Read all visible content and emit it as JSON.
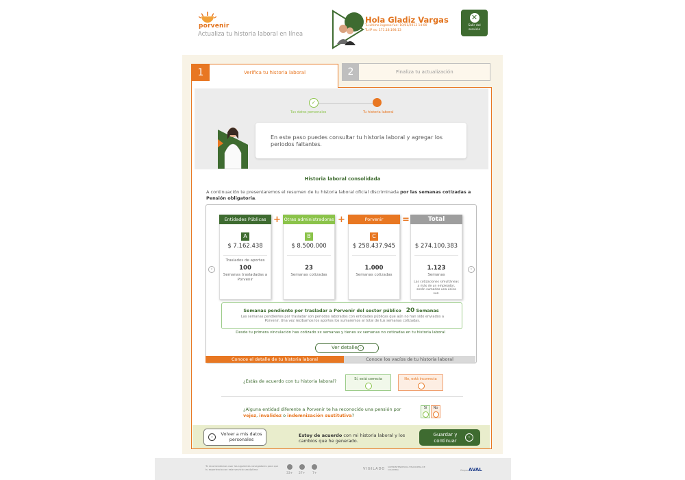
{
  "header": {
    "brand": "porvenir",
    "tagline": "Actualiza tu historia laboral en línea",
    "greeting": "Hola Gladiz Vargas",
    "last_login": "Tu último ingreso fue: 10/01/2013 14:00",
    "ip": "Tu IP es: 171.18.198.13",
    "exit_label_1": "Salir del",
    "exit_label_2": "servicio"
  },
  "tabs": [
    {
      "num": "1",
      "label": "Verifica tu historia laboral"
    },
    {
      "num": "2",
      "label": "Finaliza tu actualización"
    }
  ],
  "stepper": {
    "step1": "Tus datos personales",
    "step2": "Tu historia laboral"
  },
  "intro_bubble": "En este paso puedes consultar tu historia laboral y agregar los periodos faltantes.",
  "history": {
    "title": "Historia laboral consolidada",
    "intro_normal": "A continuación te presentaremos el resumen de tu historia laboral oficial discriminada ",
    "intro_bold": "por las semanas cotizadas a Pensión obligatoria",
    "intro_end": ".",
    "cards": [
      {
        "header": "Entidades Públicas",
        "letter": "A",
        "amount": "$ 7.162.438",
        "sub": "Traslados de aportes",
        "number": "100",
        "note": "Semanas trasladadas a Porvenir"
      },
      {
        "header": "Otras administradoras",
        "letter": "B",
        "amount": "$ 8.500.000",
        "number": "23",
        "note": "Semanas cotizadas"
      },
      {
        "header": "Porvenir",
        "letter": "C",
        "amount": "$ 258.437.945",
        "number": "1.000",
        "note": "Semanas cotizadas"
      },
      {
        "header": "Total",
        "amount": "$ 274.100.383",
        "number": "1.123",
        "note": "Semanas",
        "extra": "Las cotizaciones simultáneas a más de un empleador, serán sumadas una única vez."
      }
    ],
    "ops": [
      "+",
      "+",
      "="
    ],
    "pending_title": "Semanas pendiente por trasladar a Porvenir del sector público",
    "pending_number": "20",
    "pending_unit": "Semanas",
    "pending_text": "Las semanas pendientes por trasladar son periodos laborados con entidades públicas que aún no han sido enviados a Porvenir. Una vez recibamos los aportes los sumaremos al total de tus semanas cotizadas.",
    "since_text": "Desde tu primera vinculación has cotizado xx semanas y tienes xx semanas no cotizadas en tu historia laboral",
    "detail_button": "Ver detalle",
    "bottom_tab_left": "Conoce el detalle de tu historia laboral",
    "bottom_tab_right": "Conoce los vacíos de tu historia laboral"
  },
  "agreement": {
    "question": "¿Estás de acuerdo con tu historia laboral?",
    "yes": "Sí, está correcta",
    "no": "No, está incorrecta"
  },
  "pension_question": {
    "part1": "¿Alguna entidad diferente a Porvenir te ha reconocido una pensión por ",
    "vejez": "vejez",
    "comma": ", ",
    "invalidez": "invalidez",
    "o": " o ",
    "indemnizacion": "indemnización sustitutiva",
    "end": "?",
    "si": "Sí",
    "no": "No"
  },
  "footer_actions": {
    "back": "Volver a mis datos personales",
    "agree_bold": "Estoy de acuerdo",
    "agree_rest": " con mi historia laboral y los cambios que he generado.",
    "save": "Guardar y continuar"
  },
  "site_footer": {
    "recommend": "Te recomendamos usar los siguientes navegadores para que tu experiencia con este servicio sea óptima",
    "browsers": [
      "33+",
      "27+",
      "7+"
    ],
    "vigilado": "VIGILADO",
    "super": "SUPERINTENDENCIA FINANCIERA DE COLOMBIA",
    "group_label": "Grupo",
    "group": "AVAL"
  },
  "colors": {
    "orange": "#e87722",
    "green": "#3e6b30",
    "lightgreen": "#8bc34a",
    "grey": "#9e9e9e"
  }
}
